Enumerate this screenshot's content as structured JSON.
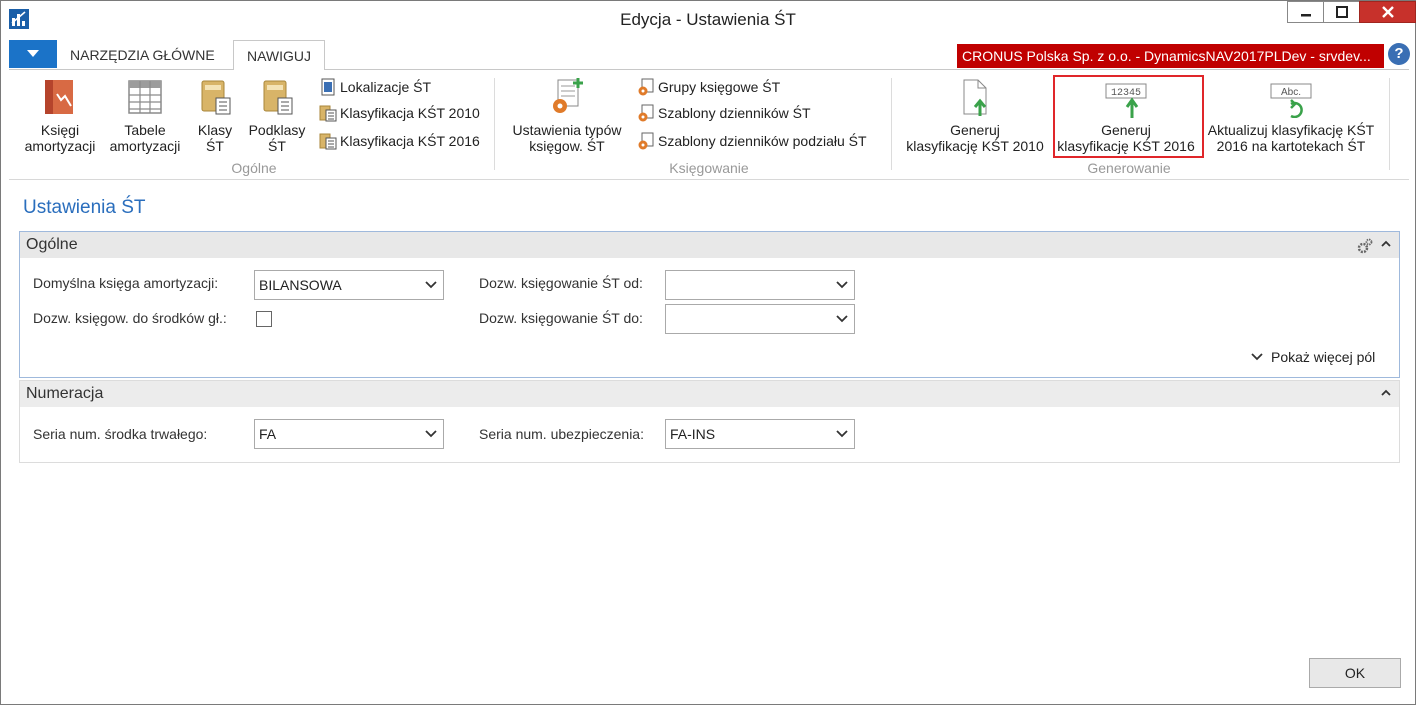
{
  "window": {
    "title": "Edycja - Ustawienia ŚT"
  },
  "tabs": {
    "home": "NARZĘDZIA GŁÓWNE",
    "navigate": "NAWIGUJ"
  },
  "company": "CRONUS Polska Sp. z o.o. - DynamicsNAV2017PLDev - srvdev...",
  "help": "?",
  "ribbon": {
    "groups": {
      "general": "Ogólne",
      "posting": "Księgowanie",
      "generate": "Generowanie"
    },
    "buttons": {
      "depr_books": [
        "Księgi",
        "amortyzacji"
      ],
      "depr_tables": [
        "Tabele",
        "amortyzacji"
      ],
      "classes": [
        "Klasy",
        "ŚT"
      ],
      "subclasses": [
        "Podklasy",
        "ŚT"
      ],
      "locations": "Lokalizacje ŚT",
      "kst2010": "Klasyfikacja KŚT 2010",
      "kst2016": "Klasyfikacja KŚT 2016",
      "posting_type_setup": [
        "Ustawienia typów",
        "księgow. ŚT"
      ],
      "posting_groups": "Grupy księgowe ŚT",
      "journal_templates": "Szablony dzienników ŚT",
      "alloc_journal_templates": "Szablony dzienników podziału ŚT",
      "gen_kst2010": [
        "Generuj",
        "klasyfikację KŚT 2010"
      ],
      "gen_kst2016": [
        "Generuj",
        "klasyfikację KŚT 2016"
      ],
      "update_kst2016": [
        "Aktualizuj klasyfikację KŚT",
        "2016 na kartotekach ŚT"
      ]
    },
    "icon_text": {
      "numbers": "12345",
      "abc": "Abc."
    }
  },
  "page": {
    "title": "Ustawienia ŚT",
    "general": {
      "header": "Ogólne",
      "default_depr_book_label": "Domyślna księga amortyzacji:",
      "default_depr_book_value": "BILANSOWA",
      "allow_posting_main_label": "Dozw. księgow. do środków gł.:",
      "allow_posting_from_label": "Dozw. księgowanie ŚT od:",
      "allow_posting_from_value": "",
      "allow_posting_to_label": "Dozw. księgowanie ŚT do:",
      "allow_posting_to_value": "",
      "show_more": "Pokaż więcej pól"
    },
    "numbering": {
      "header": "Numeracja",
      "fa_nos_label": "Seria num. środka trwałego:",
      "fa_nos_value": "FA",
      "ins_nos_label": "Seria num. ubezpieczenia:",
      "ins_nos_value": "FA-INS"
    }
  },
  "footer": {
    "ok": "OK"
  }
}
